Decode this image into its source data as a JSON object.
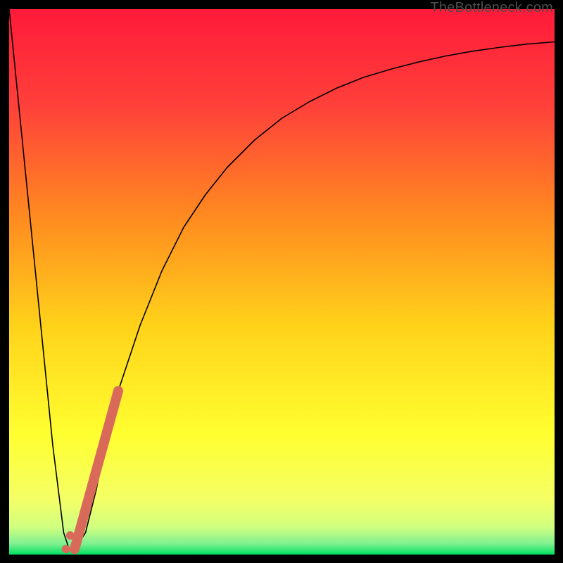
{
  "watermark": "TheBottleneck.com",
  "colors": {
    "frame": "#000000",
    "gradient_top": "#ff1a3a",
    "gradient_mid1": "#ff6a2a",
    "gradient_mid2": "#ffd21a",
    "gradient_mid3": "#ffff30",
    "gradient_mid4": "#e8ff70",
    "gradient_bottom": "#00e060",
    "curve": "#000000",
    "marker": "#d96a5a"
  },
  "chart_data": {
    "type": "line",
    "title": "",
    "xlabel": "",
    "ylabel": "",
    "xlim": [
      0,
      100
    ],
    "ylim": [
      0,
      100
    ],
    "series": [
      {
        "name": "bottleneck-curve",
        "x": [
          0,
          6,
          8,
          10,
          11,
          12,
          14,
          16,
          18,
          20,
          24,
          28,
          32,
          36,
          40,
          45,
          50,
          55,
          60,
          65,
          70,
          75,
          80,
          85,
          90,
          95,
          100
        ],
        "values": [
          100,
          40,
          20,
          4,
          1,
          1,
          4,
          12,
          22,
          30,
          42,
          52,
          60,
          66,
          71,
          76,
          80,
          83,
          85.5,
          87.5,
          89,
          90.3,
          91.4,
          92.3,
          93,
          93.6,
          94
        ]
      }
    ],
    "markers": [
      {
        "name": "segment-highlight",
        "x": [
          12,
          20
        ],
        "y": [
          1,
          30
        ],
        "style": "thick-rounded"
      },
      {
        "name": "dot-1",
        "x": 11.2,
        "y": 3.5
      },
      {
        "name": "dot-2",
        "x": 10.4,
        "y": 1
      }
    ],
    "annotations": []
  }
}
